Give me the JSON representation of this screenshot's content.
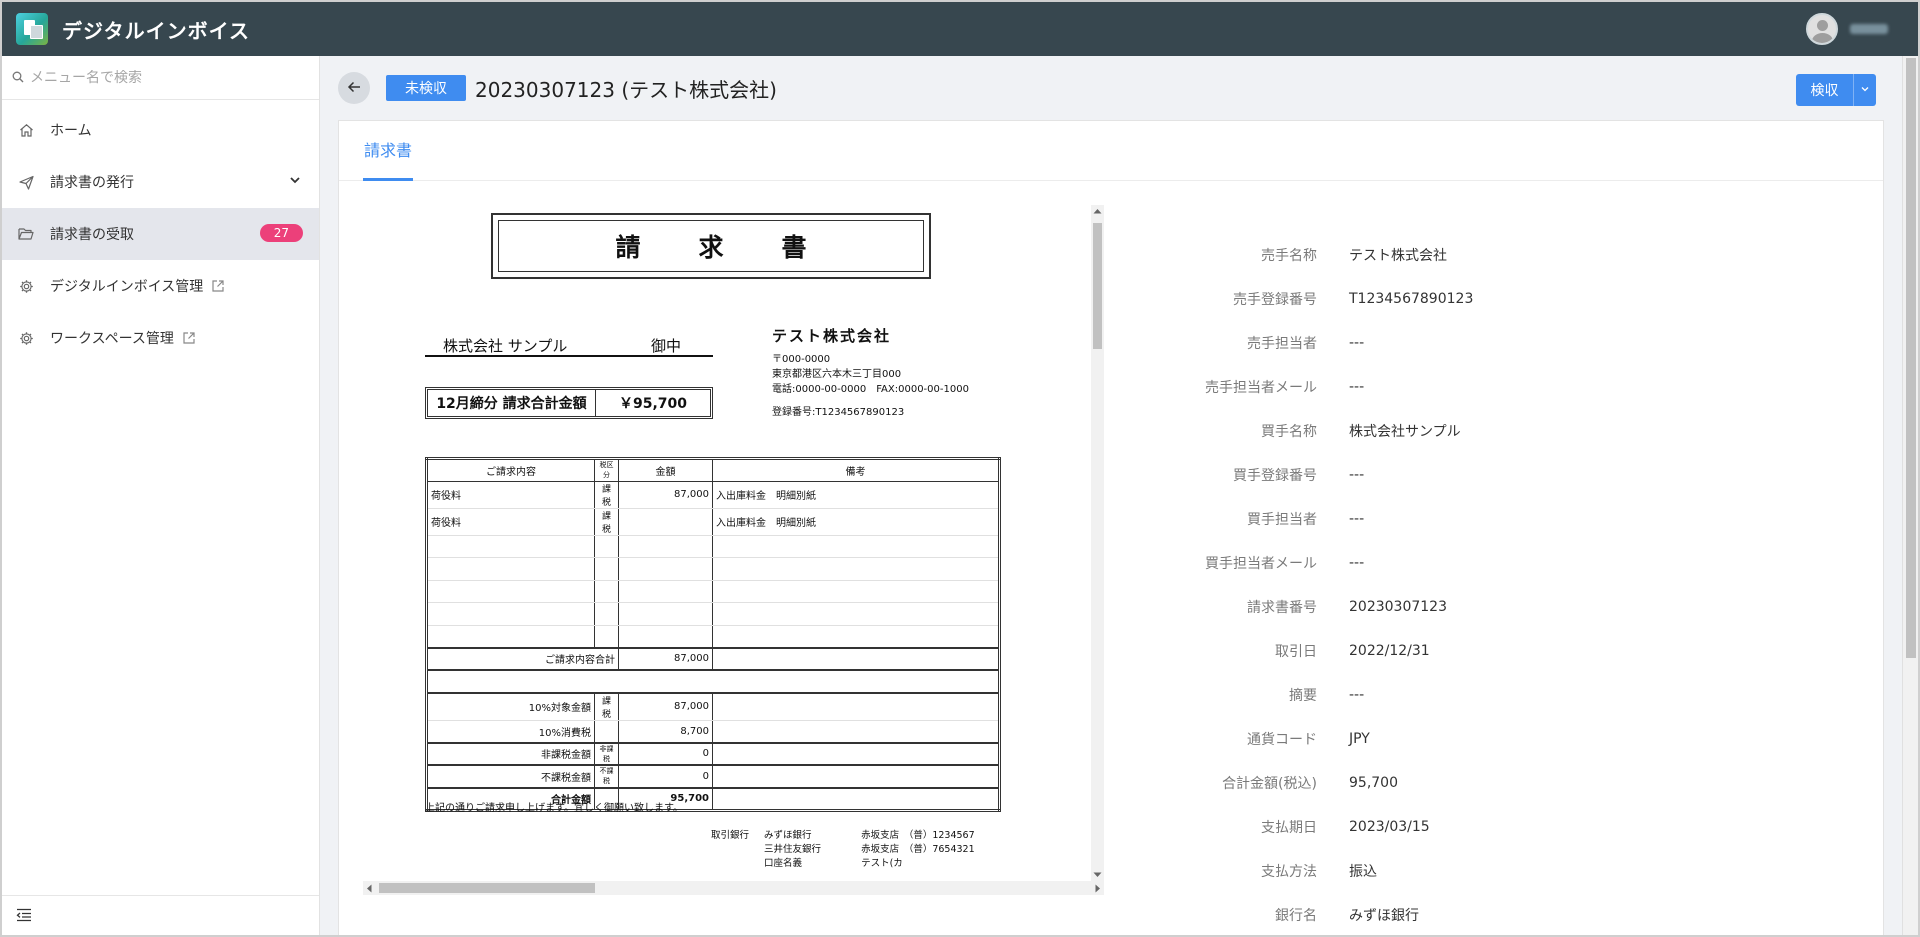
{
  "app": {
    "title": "デジタルインボイス"
  },
  "sidebar": {
    "search_placeholder": "メニュー名で検索",
    "items": [
      {
        "label": "ホーム",
        "icon": "home-icon"
      },
      {
        "label": "請求書の発行",
        "icon": "send-icon"
      },
      {
        "label": "請求書の受取",
        "icon": "folder-open-icon",
        "badge": "27"
      },
      {
        "label": "デジタルインボイス管理",
        "icon": "gear-icon"
      },
      {
        "label": "ワークスペース管理",
        "icon": "gear-icon"
      }
    ]
  },
  "header": {
    "status": "未検収",
    "title": "20230307123 (テスト株式会社)",
    "action_label": "検収"
  },
  "tabs": [
    {
      "label": "請求書"
    }
  ],
  "invoice_doc": {
    "title": "請求書",
    "to_name": "株式会社 サンプル",
    "to_honorific": "御中",
    "seller_name": "テスト株式会社",
    "seller_zip": "〒000-0000",
    "seller_address": "東京都港区六本木三丁目000",
    "seller_tel": "電話:0000-00-0000　FAX:0000-00-1000",
    "seller_reg": "登録番号:T1234567890123",
    "total_label": "12月締分 請求合計金額",
    "total_value": "￥95,700",
    "table_headers": [
      "ご請求内容",
      "税区分",
      "金額",
      "備考"
    ],
    "rows": [
      {
        "item": "荷役料",
        "tax": "課税",
        "amount": "87,000",
        "note": "入出庫料金　明細別紙"
      },
      {
        "item": "荷役料",
        "tax": "課税",
        "amount": "",
        "note": "入出庫料金　明細別紙"
      }
    ],
    "subtotal_label": "ご請求内容合計",
    "subtotal_value": "87,000",
    "summary": [
      {
        "label": "10%対象金額",
        "tax": "課税",
        "amount": "87,000"
      },
      {
        "label": "10%消費税",
        "tax": "",
        "amount": "8,700"
      },
      {
        "label": "非課税金額",
        "tax": "非課税",
        "amount": "0"
      },
      {
        "label": "不課税金額",
        "tax": "不課税",
        "amount": "0"
      },
      {
        "label": "合計金額",
        "tax": "",
        "amount": "95,700"
      }
    ],
    "note": "上記の通りご請求申し上げます。宜しく御願い致します。",
    "bank_label": "取引銀行",
    "bank_names": [
      "みずほ銀行",
      "三井住友銀行",
      "口座名義"
    ],
    "bank_branches": [
      "赤坂支店　（普）1234567",
      "赤坂支店　（普）7654321",
      "テスト(カ"
    ]
  },
  "details": [
    {
      "label": "売手名称",
      "value": "テスト株式会社"
    },
    {
      "label": "売手登録番号",
      "value": "T1234567890123"
    },
    {
      "label": "売手担当者",
      "value": "---"
    },
    {
      "label": "売手担当者メール",
      "value": "---"
    },
    {
      "label": "買手名称",
      "value": "株式会社サンプル"
    },
    {
      "label": "買手登録番号",
      "value": "---"
    },
    {
      "label": "買手担当者",
      "value": "---"
    },
    {
      "label": "買手担当者メール",
      "value": "---"
    },
    {
      "label": "請求書番号",
      "value": "20230307123"
    },
    {
      "label": "取引日",
      "value": "2022/12/31"
    },
    {
      "label": "摘要",
      "value": "---"
    },
    {
      "label": "通貨コード",
      "value": "JPY"
    },
    {
      "label": "合計金額(税込)",
      "value": "95,700"
    },
    {
      "label": "支払期日",
      "value": "2023/03/15"
    },
    {
      "label": "支払方法",
      "value": "振込"
    },
    {
      "label": "銀行名",
      "value": "みずほ銀行"
    }
  ],
  "colors": {
    "topbar": "#37474f",
    "accent": "#3f8cf0",
    "badge": "#ec407a"
  }
}
